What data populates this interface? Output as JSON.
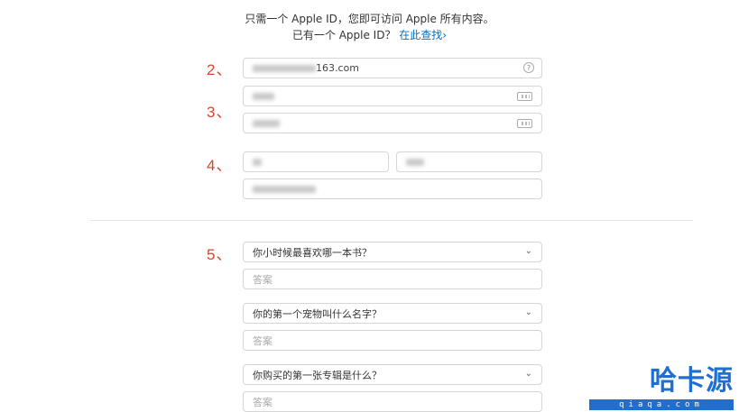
{
  "intro": {
    "line1": "只需一个 Apple ID，您即可访问 Apple 所有内容。",
    "line2_prefix": "已有一个 Apple ID？",
    "line2_link": "在此查找›"
  },
  "steps": {
    "s2": "2、",
    "s3": "3、",
    "s4": "4、",
    "s5": "5、"
  },
  "email": {
    "suffix": "163.com",
    "help_icon": "?"
  },
  "security_questions": [
    {
      "question": "你小时候最喜欢哪一本书？",
      "answer_placeholder": "答案"
    },
    {
      "question": "你的第一个宠物叫什么名字？",
      "answer_placeholder": "答案"
    },
    {
      "question": "你购买的第一张专辑是什么？",
      "answer_placeholder": "答案"
    }
  ],
  "icons": {
    "password_field": "keyboard-icon",
    "email_help": "help-circle-icon",
    "select": "chevron-down-icon"
  },
  "watermark": {
    "logo": "哈卡源",
    "sub": "qiaqa.com"
  },
  "colors": {
    "step": "#d4472f",
    "link": "#0070c9",
    "watermark": "#1f6fd1"
  }
}
